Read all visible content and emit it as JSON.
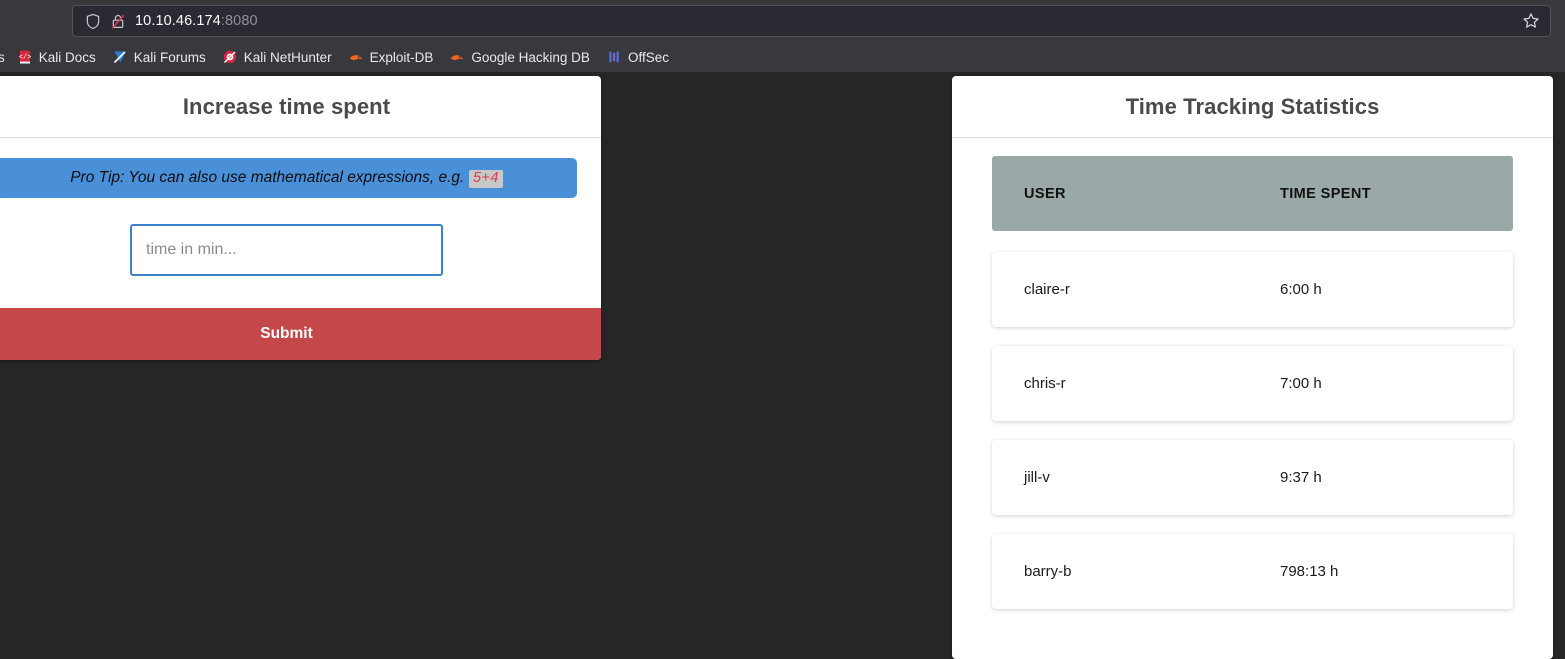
{
  "browser": {
    "url_host": "10.10.46.174",
    "url_port": ":8080",
    "shield_icon": "shield-icon",
    "lock_icon": "lock-crossed-icon",
    "bookmark_star_icon": "star-outline-icon",
    "bookmarks": [
      {
        "label": "s",
        "icon": "cut-off-bookmark-icon",
        "cut": true
      },
      {
        "label": "Kali Docs",
        "icon": "kali-docs-icon"
      },
      {
        "label": "Kali Forums",
        "icon": "kali-forums-icon"
      },
      {
        "label": "Kali NetHunter",
        "icon": "kali-nethunter-icon"
      },
      {
        "label": "Exploit-DB",
        "icon": "exploit-db-icon"
      },
      {
        "label": "Google Hacking DB",
        "icon": "google-hacking-db-icon"
      },
      {
        "label": "OffSec",
        "icon": "offsec-icon"
      }
    ]
  },
  "form_card": {
    "title": "Increase time spent",
    "protip_prefix": "Pro Tip: You can also use mathematical expressions, e.g.",
    "protip_code": "5+4",
    "input_placeholder": "time in min...",
    "input_value": "",
    "submit_label": "Submit"
  },
  "stats_card": {
    "title": "Time Tracking Statistics",
    "columns": [
      "USER",
      "TIME SPENT"
    ],
    "rows": [
      {
        "user": "claire-r",
        "time": "6:00 h"
      },
      {
        "user": "chris-r",
        "time": "7:00 h"
      },
      {
        "user": "jill-v",
        "time": "9:37 h"
      },
      {
        "user": "barry-b",
        "time": "798:13 h"
      }
    ]
  },
  "colors": {
    "page_background": "#262626",
    "protip_blue": "#4a90d9",
    "submit_red": "#c4474a",
    "table_header": "#9aa8a8",
    "input_focus_border": "#3c80d0",
    "code_text": "#e03b4a"
  }
}
